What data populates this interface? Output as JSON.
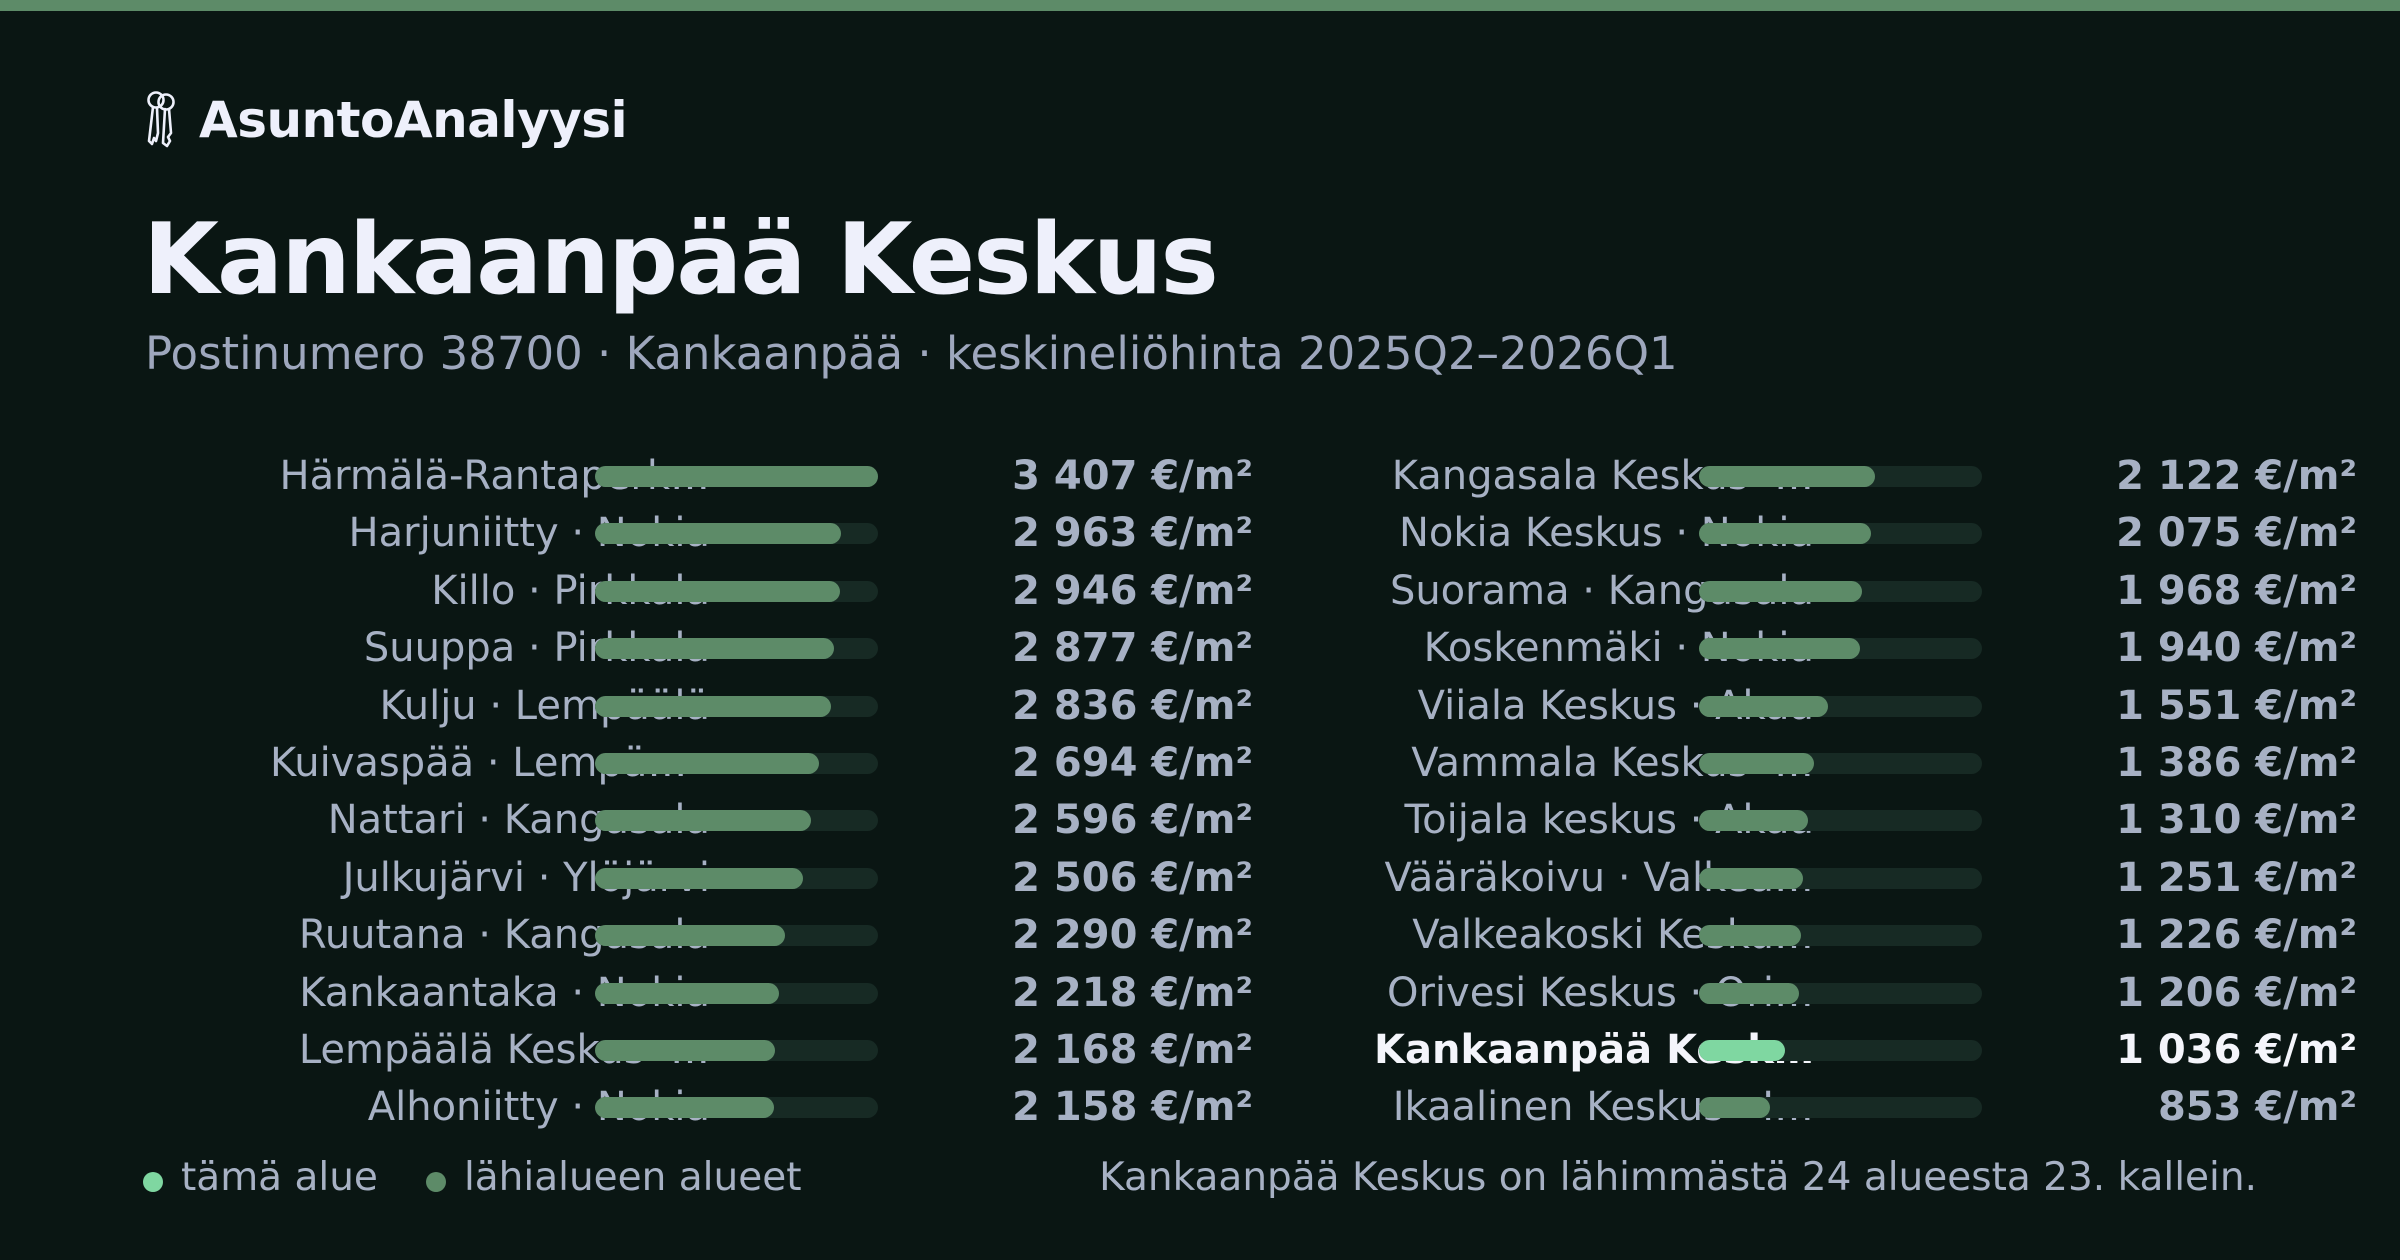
{
  "brand": {
    "icon": "keys-icon",
    "name": "AsuntoAnalyysi"
  },
  "title": "Kankaanpää Keskus",
  "subtitle": "Postinumero 38700 · Kankaanpää · keskineliöhinta 2025Q2–2026Q1",
  "colors": {
    "background": "#0a1613",
    "bar": "#5d8b68",
    "highlight_bar": "#7fd7a1",
    "track": "#172a24",
    "top_accent": "#5d8b68"
  },
  "chart_data": {
    "type": "bar",
    "orientation": "horizontal",
    "unit": "€/m²",
    "xlim": [
      0,
      3407
    ],
    "columns": [
      [
        {
          "label": "Härmälä-Rantaperk…",
          "value": 3407,
          "value_label": "3 407 €/m²"
        },
        {
          "label": "Harjuniitty · Nokia",
          "value": 2963,
          "value_label": "2 963 €/m²"
        },
        {
          "label": "Killo · Pirkkala",
          "value": 2946,
          "value_label": "2 946 €/m²"
        },
        {
          "label": "Suuppa · Pirkkala",
          "value": 2877,
          "value_label": "2 877 €/m²"
        },
        {
          "label": "Kulju · Lempäälä",
          "value": 2836,
          "value_label": "2 836 €/m²"
        },
        {
          "label": "Kuivaspää · Lempää…",
          "value": 2694,
          "value_label": "2 694 €/m²"
        },
        {
          "label": "Nattari · Kangasala",
          "value": 2596,
          "value_label": "2 596 €/m²"
        },
        {
          "label": "Julkujärvi · Ylöjärvi",
          "value": 2506,
          "value_label": "2 506 €/m²"
        },
        {
          "label": "Ruutana · Kangasala",
          "value": 2290,
          "value_label": "2 290 €/m²"
        },
        {
          "label": "Kankaantaka · Nokia",
          "value": 2218,
          "value_label": "2 218 €/m²"
        },
        {
          "label": "Lempäälä Keskus ·…",
          "value": 2168,
          "value_label": "2 168 €/m²"
        },
        {
          "label": "Alhoniitty · Nokia",
          "value": 2158,
          "value_label": "2 158 €/m²"
        }
      ],
      [
        {
          "label": "Kangasala Keskus ·…",
          "value": 2122,
          "value_label": "2 122 €/m²"
        },
        {
          "label": "Nokia Keskus · Nokia",
          "value": 2075,
          "value_label": "2 075 €/m²"
        },
        {
          "label": "Suorama · Kangasala",
          "value": 1968,
          "value_label": "1 968 €/m²"
        },
        {
          "label": "Koskenmäki · Nokia",
          "value": 1940,
          "value_label": "1 940 €/m²"
        },
        {
          "label": "Viiala Keskus · Akaa",
          "value": 1551,
          "value_label": "1 551 €/m²"
        },
        {
          "label": "Vammala Keskus ·…",
          "value": 1386,
          "value_label": "1 386 €/m²"
        },
        {
          "label": "Toijala keskus · Akaa",
          "value": 1310,
          "value_label": "1 310 €/m²"
        },
        {
          "label": "Vääräkoivu · Valkea…",
          "value": 1251,
          "value_label": "1 251 €/m²"
        },
        {
          "label": "Valkeakoski Kesku…",
          "value": 1226,
          "value_label": "1 226 €/m²"
        },
        {
          "label": "Orivesi Keskus · Ori…",
          "value": 1206,
          "value_label": "1 206 €/m²"
        },
        {
          "label": "Kankaanpää Kesku…",
          "value": 1036,
          "value_label": "1 036 €/m²",
          "highlight": true
        },
        {
          "label": "Ikaalinen Keskus · I…",
          "value": 853,
          "value_label": "853 €/m²"
        }
      ]
    ],
    "legend": [
      {
        "label": "tämä alue",
        "color": "#7fd7a1"
      },
      {
        "label": "lähialueen alueet",
        "color": "#5d8b68"
      }
    ],
    "legend_position": "bottom-left"
  },
  "footnote": "Kankaanpää Keskus on lähimmästä 24 alueesta 23. kallein."
}
